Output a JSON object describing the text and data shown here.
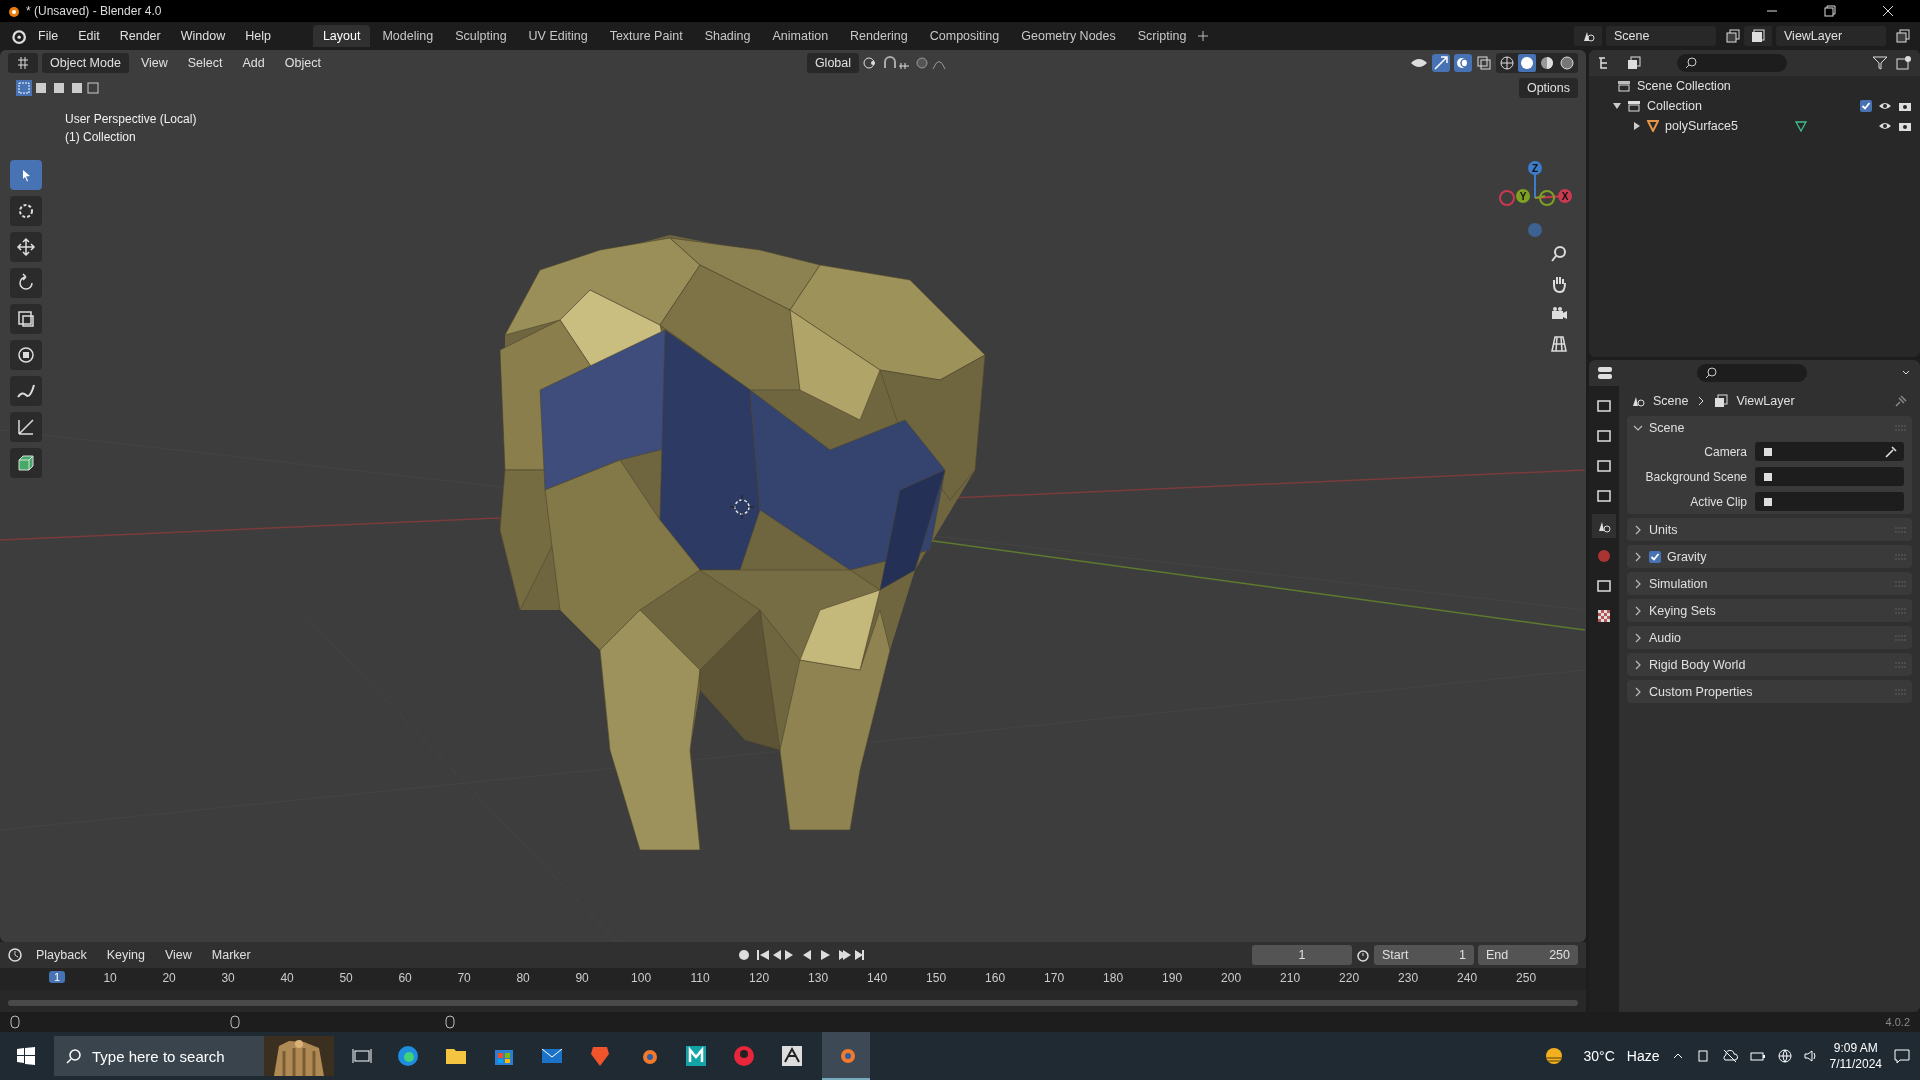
{
  "window": {
    "title": "* (Unsaved) - Blender 4.0"
  },
  "menu": [
    "File",
    "Edit",
    "Render",
    "Window",
    "Help"
  ],
  "workspaces": [
    {
      "label": "Layout",
      "selected": true
    },
    {
      "label": "Modeling",
      "selected": false
    },
    {
      "label": "Sculpting",
      "selected": false
    },
    {
      "label": "UV Editing",
      "selected": false
    },
    {
      "label": "Texture Paint",
      "selected": false
    },
    {
      "label": "Shading",
      "selected": false
    },
    {
      "label": "Animation",
      "selected": false
    },
    {
      "label": "Rendering",
      "selected": false
    },
    {
      "label": "Compositing",
      "selected": false
    },
    {
      "label": "Geometry Nodes",
      "selected": false
    },
    {
      "label": "Scripting",
      "selected": false
    }
  ],
  "scene_field": "Scene",
  "view_layer_field": "ViewLayer",
  "viewport_header": {
    "mode": "Object Mode",
    "menus": [
      "View",
      "Select",
      "Add",
      "Object"
    ],
    "orientation": "Global",
    "options": "Options"
  },
  "viewport": {
    "overlay_lines": [
      "User Perspective (Local)",
      "(1) Collection"
    ],
    "gizmo_axes": [
      "Z",
      "Y",
      "X"
    ]
  },
  "outliner": {
    "tree": [
      {
        "label": "Scene Collection",
        "kind": "root",
        "children": [
          {
            "label": "Collection",
            "kind": "collection",
            "expanded": true,
            "checked": true,
            "children": [
              {
                "label": "polySurface5",
                "kind": "mesh",
                "expanded": false
              }
            ]
          }
        ]
      }
    ]
  },
  "properties": {
    "breadcrumb": [
      "Scene",
      "ViewLayer"
    ],
    "panels": [
      {
        "label": "Scene",
        "kind": "plain",
        "expanded": true,
        "fields": [
          "Camera",
          "Background Scene",
          "Active Clip"
        ]
      },
      {
        "label": "Units",
        "kind": "plain",
        "expanded": false
      },
      {
        "label": "Gravity",
        "kind": "checkbox",
        "checked": true,
        "expanded": false
      },
      {
        "label": "Simulation",
        "kind": "plain",
        "expanded": false
      },
      {
        "label": "Keying Sets",
        "kind": "plain",
        "expanded": false
      },
      {
        "label": "Audio",
        "kind": "plain",
        "expanded": false
      },
      {
        "label": "Rigid Body World",
        "kind": "plain",
        "expanded": false
      },
      {
        "label": "Custom Properties",
        "kind": "plain",
        "expanded": false
      }
    ]
  },
  "timeline": {
    "menus": [
      "Playback",
      "Keying",
      "View",
      "Marker"
    ],
    "current_frame": "1",
    "start_label": "Start",
    "start": "1",
    "end_label": "End",
    "end": "250",
    "playhead": "1",
    "ruler": [
      "10",
      "20",
      "30",
      "40",
      "50",
      "60",
      "70",
      "80",
      "90",
      "100",
      "110",
      "120",
      "130",
      "140",
      "150",
      "160",
      "170",
      "180",
      "190",
      "200",
      "210",
      "220",
      "230",
      "240",
      "250"
    ]
  },
  "status_bar": {
    "version": "4.0.2"
  },
  "taskbar": {
    "search_placeholder": "Type here to search",
    "temperature": "30°C",
    "weather": "Haze",
    "time": "9:09 AM",
    "date": "7/11/2024"
  }
}
